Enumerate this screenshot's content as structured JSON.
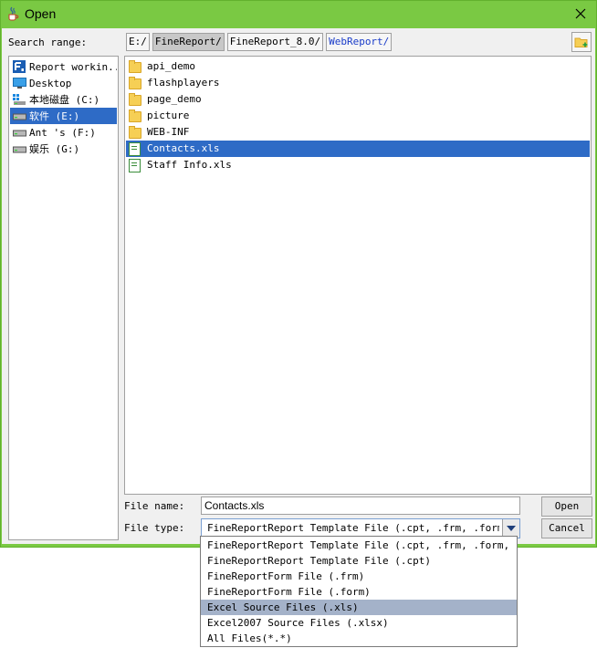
{
  "window": {
    "title": "Open"
  },
  "search": {
    "label": "Search range:"
  },
  "breadcrumbs": [
    "E:/",
    "FineReport/",
    "FineReport_8.0/",
    "WebReport/"
  ],
  "sidebar": {
    "items": [
      {
        "label": "Report workin...",
        "icon": "report-icon"
      },
      {
        "label": "Desktop",
        "icon": "desktop-icon"
      },
      {
        "label": "本地磁盘 (C:)",
        "icon": "drive-icon"
      },
      {
        "label": "软件 (E:)",
        "icon": "drive-icon",
        "selected": true
      },
      {
        "label": "Ant 's  (F:)",
        "icon": "drive-icon"
      },
      {
        "label": "娱乐 (G:)",
        "icon": "drive-icon"
      }
    ]
  },
  "files": {
    "items": [
      {
        "name": "api_demo",
        "type": "folder"
      },
      {
        "name": "flashplayers",
        "type": "folder"
      },
      {
        "name": "page_demo",
        "type": "folder"
      },
      {
        "name": "picture",
        "type": "folder"
      },
      {
        "name": "WEB-INF",
        "type": "folder"
      },
      {
        "name": "Contacts.xls",
        "type": "xls",
        "selected": true
      },
      {
        "name": "Staff Info.xls",
        "type": "xls"
      }
    ]
  },
  "form": {
    "filename_label": "File name:",
    "filename_value": "Contacts.xls",
    "filetype_label": "File type:",
    "filetype_value": "FineReportReport Template File (.cpt, .frm, .form,...",
    "open_label": "Open",
    "cancel_label": "Cancel"
  },
  "filetype_options": [
    "FineReportReport Template File (.cpt, .frm, .form, .cht,",
    "FineReportReport Template File (.cpt)",
    "FineReportForm File (.frm)",
    "FineReportForm File (.form)",
    "Excel Source Files (.xls)",
    "Excel2007 Source Files (.xlsx)",
    "All Files(*.*)"
  ],
  "filetype_highlighted": "Excel Source Files (.xls)",
  "colors": {
    "title_bar": "#7ac943",
    "selection": "#2e6bc6",
    "dropdown_highlight": "#a4b2c9"
  }
}
